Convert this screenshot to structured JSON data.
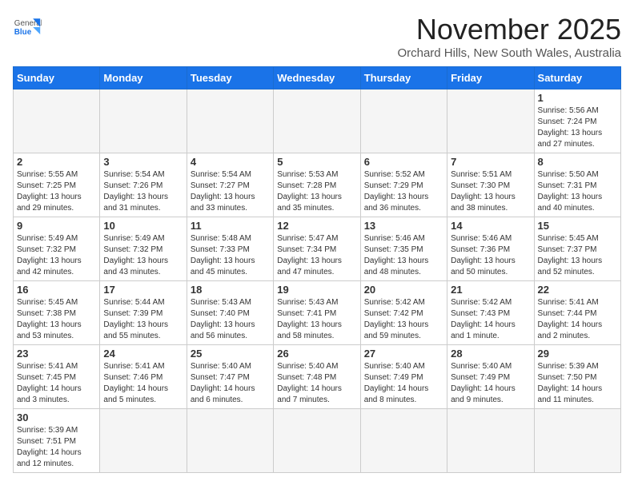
{
  "header": {
    "logo_general": "General",
    "logo_blue": "Blue",
    "month": "November 2025",
    "location": "Orchard Hills, New South Wales, Australia"
  },
  "days_of_week": [
    "Sunday",
    "Monday",
    "Tuesday",
    "Wednesday",
    "Thursday",
    "Friday",
    "Saturday"
  ],
  "weeks": [
    [
      {
        "num": "",
        "info": ""
      },
      {
        "num": "",
        "info": ""
      },
      {
        "num": "",
        "info": ""
      },
      {
        "num": "",
        "info": ""
      },
      {
        "num": "",
        "info": ""
      },
      {
        "num": "",
        "info": ""
      },
      {
        "num": "1",
        "info": "Sunrise: 5:56 AM\nSunset: 7:24 PM\nDaylight: 13 hours\nand 27 minutes."
      }
    ],
    [
      {
        "num": "2",
        "info": "Sunrise: 5:55 AM\nSunset: 7:25 PM\nDaylight: 13 hours\nand 29 minutes."
      },
      {
        "num": "3",
        "info": "Sunrise: 5:54 AM\nSunset: 7:26 PM\nDaylight: 13 hours\nand 31 minutes."
      },
      {
        "num": "4",
        "info": "Sunrise: 5:54 AM\nSunset: 7:27 PM\nDaylight: 13 hours\nand 33 minutes."
      },
      {
        "num": "5",
        "info": "Sunrise: 5:53 AM\nSunset: 7:28 PM\nDaylight: 13 hours\nand 35 minutes."
      },
      {
        "num": "6",
        "info": "Sunrise: 5:52 AM\nSunset: 7:29 PM\nDaylight: 13 hours\nand 36 minutes."
      },
      {
        "num": "7",
        "info": "Sunrise: 5:51 AM\nSunset: 7:30 PM\nDaylight: 13 hours\nand 38 minutes."
      },
      {
        "num": "8",
        "info": "Sunrise: 5:50 AM\nSunset: 7:31 PM\nDaylight: 13 hours\nand 40 minutes."
      }
    ],
    [
      {
        "num": "9",
        "info": "Sunrise: 5:49 AM\nSunset: 7:32 PM\nDaylight: 13 hours\nand 42 minutes."
      },
      {
        "num": "10",
        "info": "Sunrise: 5:49 AM\nSunset: 7:32 PM\nDaylight: 13 hours\nand 43 minutes."
      },
      {
        "num": "11",
        "info": "Sunrise: 5:48 AM\nSunset: 7:33 PM\nDaylight: 13 hours\nand 45 minutes."
      },
      {
        "num": "12",
        "info": "Sunrise: 5:47 AM\nSunset: 7:34 PM\nDaylight: 13 hours\nand 47 minutes."
      },
      {
        "num": "13",
        "info": "Sunrise: 5:46 AM\nSunset: 7:35 PM\nDaylight: 13 hours\nand 48 minutes."
      },
      {
        "num": "14",
        "info": "Sunrise: 5:46 AM\nSunset: 7:36 PM\nDaylight: 13 hours\nand 50 minutes."
      },
      {
        "num": "15",
        "info": "Sunrise: 5:45 AM\nSunset: 7:37 PM\nDaylight: 13 hours\nand 52 minutes."
      }
    ],
    [
      {
        "num": "16",
        "info": "Sunrise: 5:45 AM\nSunset: 7:38 PM\nDaylight: 13 hours\nand 53 minutes."
      },
      {
        "num": "17",
        "info": "Sunrise: 5:44 AM\nSunset: 7:39 PM\nDaylight: 13 hours\nand 55 minutes."
      },
      {
        "num": "18",
        "info": "Sunrise: 5:43 AM\nSunset: 7:40 PM\nDaylight: 13 hours\nand 56 minutes."
      },
      {
        "num": "19",
        "info": "Sunrise: 5:43 AM\nSunset: 7:41 PM\nDaylight: 13 hours\nand 58 minutes."
      },
      {
        "num": "20",
        "info": "Sunrise: 5:42 AM\nSunset: 7:42 PM\nDaylight: 13 hours\nand 59 minutes."
      },
      {
        "num": "21",
        "info": "Sunrise: 5:42 AM\nSunset: 7:43 PM\nDaylight: 14 hours\nand 1 minute."
      },
      {
        "num": "22",
        "info": "Sunrise: 5:41 AM\nSunset: 7:44 PM\nDaylight: 14 hours\nand 2 minutes."
      }
    ],
    [
      {
        "num": "23",
        "info": "Sunrise: 5:41 AM\nSunset: 7:45 PM\nDaylight: 14 hours\nand 3 minutes."
      },
      {
        "num": "24",
        "info": "Sunrise: 5:41 AM\nSunset: 7:46 PM\nDaylight: 14 hours\nand 5 minutes."
      },
      {
        "num": "25",
        "info": "Sunrise: 5:40 AM\nSunset: 7:47 PM\nDaylight: 14 hours\nand 6 minutes."
      },
      {
        "num": "26",
        "info": "Sunrise: 5:40 AM\nSunset: 7:48 PM\nDaylight: 14 hours\nand 7 minutes."
      },
      {
        "num": "27",
        "info": "Sunrise: 5:40 AM\nSunset: 7:49 PM\nDaylight: 14 hours\nand 8 minutes."
      },
      {
        "num": "28",
        "info": "Sunrise: 5:40 AM\nSunset: 7:49 PM\nDaylight: 14 hours\nand 9 minutes."
      },
      {
        "num": "29",
        "info": "Sunrise: 5:39 AM\nSunset: 7:50 PM\nDaylight: 14 hours\nand 11 minutes."
      }
    ],
    [
      {
        "num": "30",
        "info": "Sunrise: 5:39 AM\nSunset: 7:51 PM\nDaylight: 14 hours\nand 12 minutes."
      },
      {
        "num": "",
        "info": ""
      },
      {
        "num": "",
        "info": ""
      },
      {
        "num": "",
        "info": ""
      },
      {
        "num": "",
        "info": ""
      },
      {
        "num": "",
        "info": ""
      },
      {
        "num": "",
        "info": ""
      }
    ]
  ]
}
